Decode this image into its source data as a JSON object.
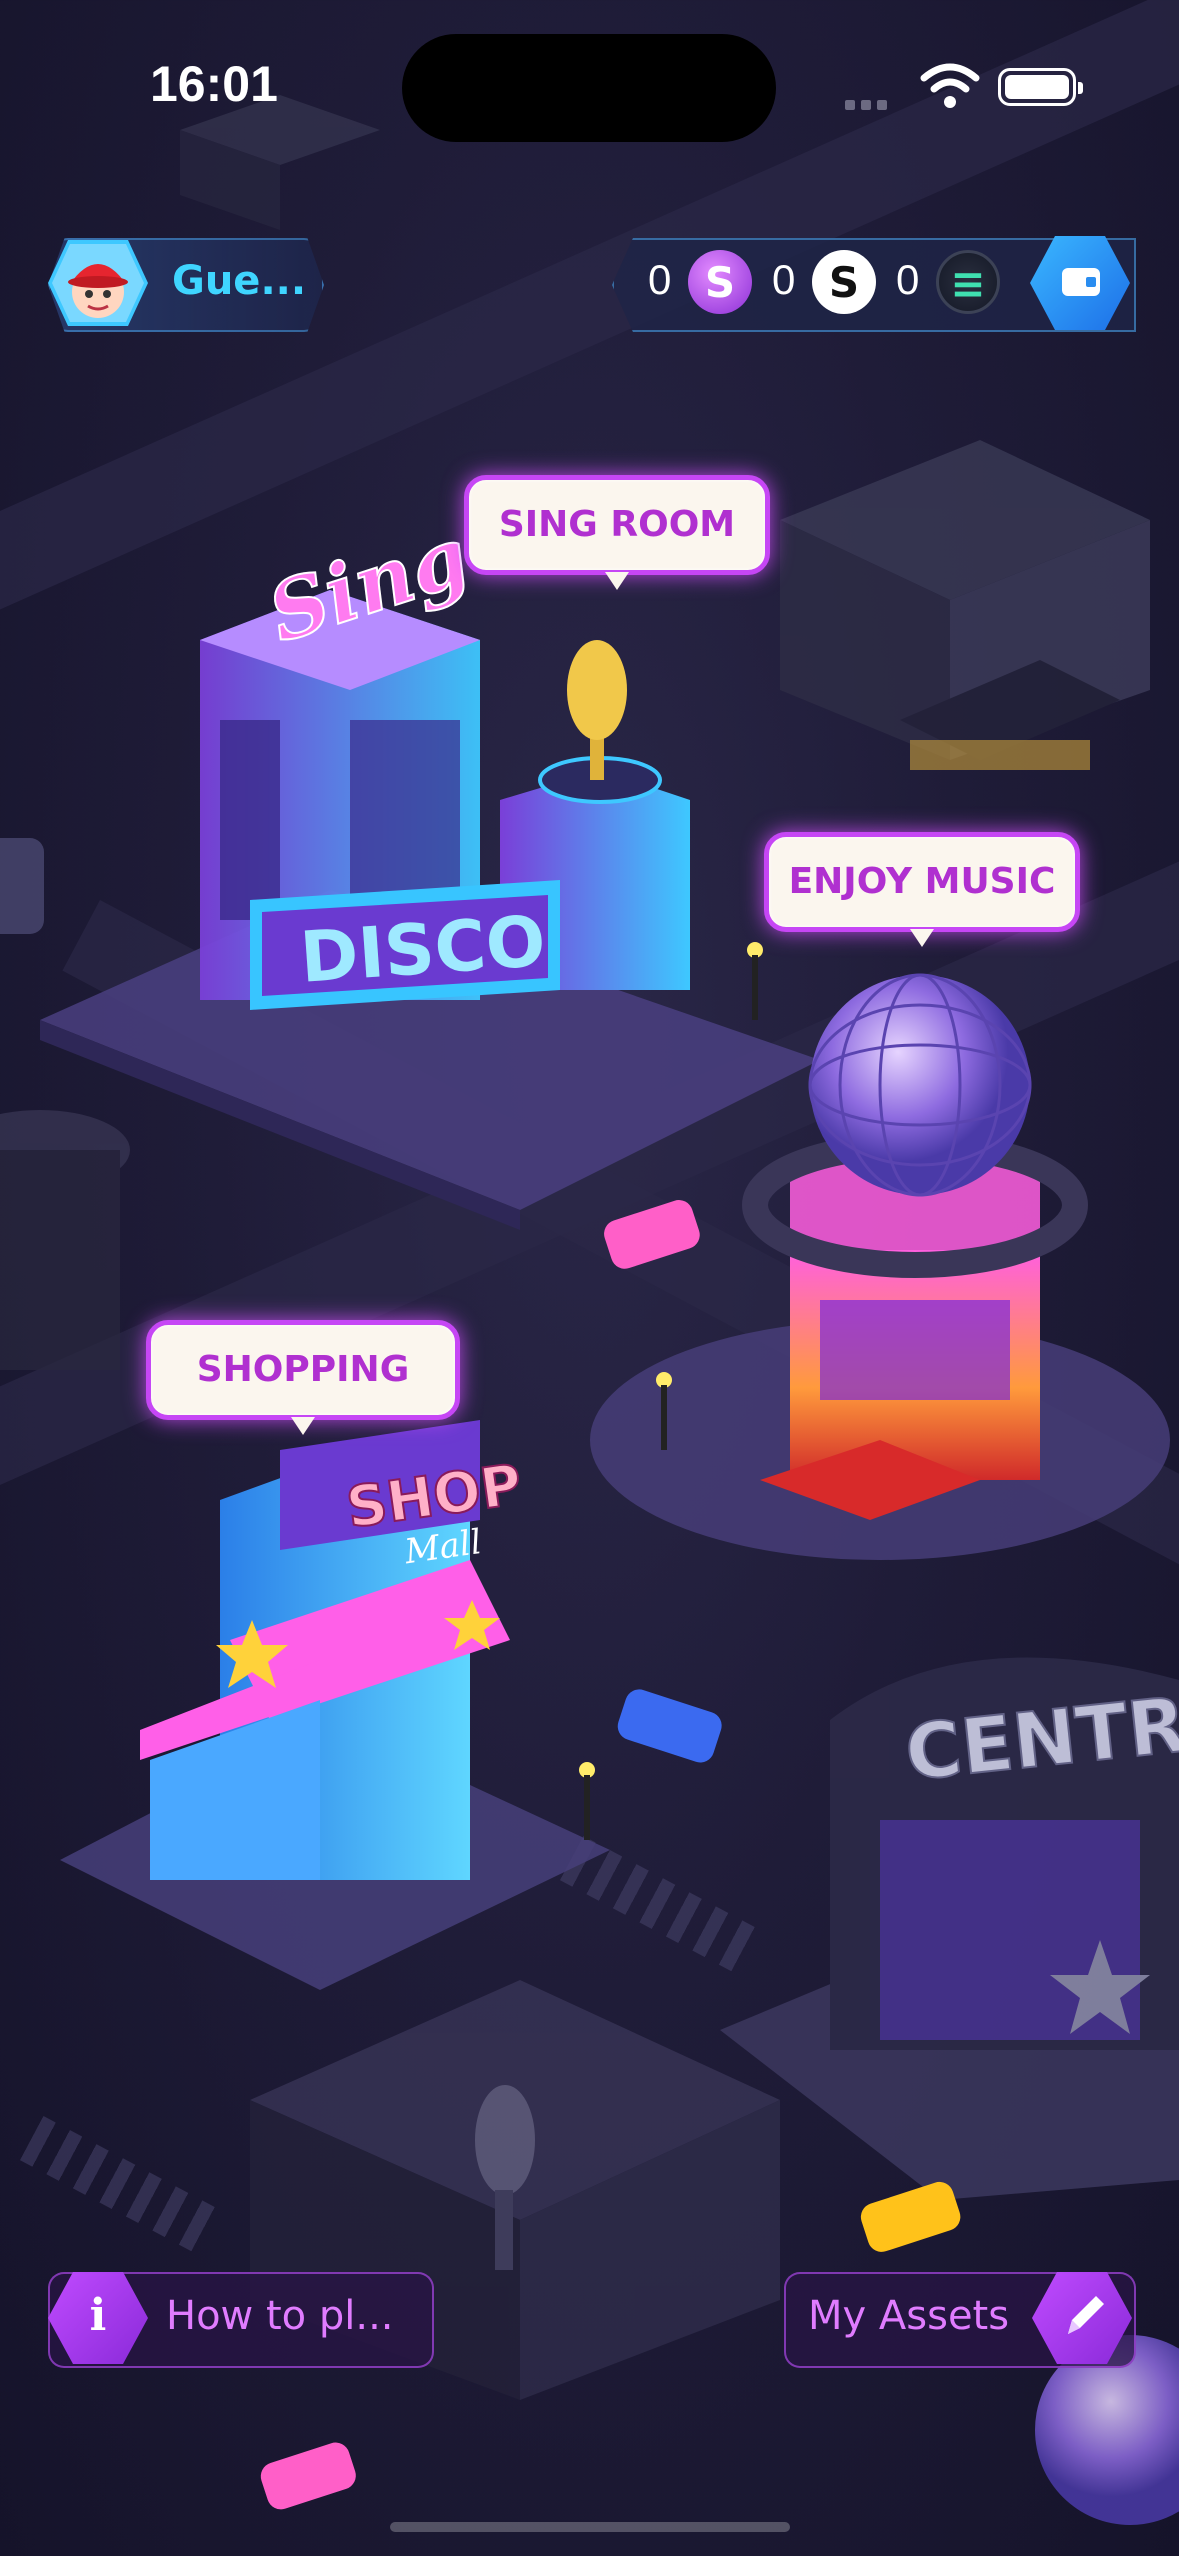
{
  "status_bar": {
    "time": "16:01"
  },
  "user": {
    "name": "Gue..."
  },
  "currencies": [
    {
      "amount": "0",
      "icon": "s-coin-purple-icon",
      "glyph": "S"
    },
    {
      "amount": "0",
      "icon": "s-coin-white-icon",
      "glyph": "S"
    },
    {
      "amount": "0",
      "icon": "solana-coin-icon",
      "glyph": "≡"
    }
  ],
  "map": {
    "locations": [
      {
        "id": "sing-room",
        "label": "SING ROOM",
        "sign": "Sing",
        "marquee": "DISCO"
      },
      {
        "id": "enjoy-music",
        "label": "ENJOY MUSIC"
      },
      {
        "id": "shopping",
        "label": "SHOPPING",
        "sign": "SHOP",
        "sign_sub": "Mall"
      },
      {
        "id": "central",
        "sign": "CENTRAL"
      }
    ]
  },
  "bottom": {
    "how_to_play": {
      "label": "How to pl...",
      "icon_glyph": "i"
    },
    "my_assets": {
      "label": "My Assets"
    }
  },
  "colors": {
    "accent": "#c646f5",
    "cyan": "#3fd5ff",
    "wallet": "#2a8df0",
    "background": "#1f1c38"
  }
}
